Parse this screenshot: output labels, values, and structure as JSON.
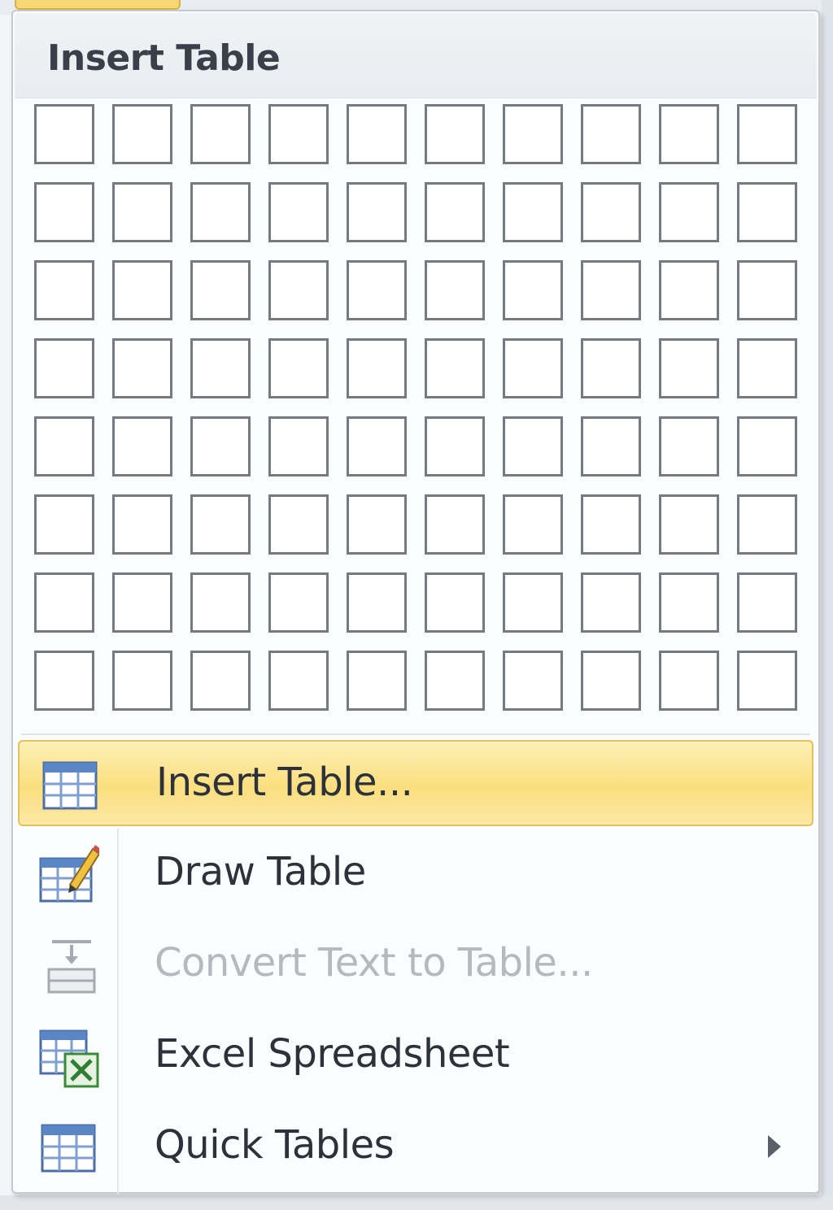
{
  "menu": {
    "header": "Insert Table",
    "grid": {
      "rows": 8,
      "columns": 10
    },
    "items": [
      {
        "label": "Insert Table...",
        "icon": "table-icon",
        "highlighted": true,
        "enabled": true
      },
      {
        "label": "Draw Table",
        "icon": "draw-table-icon",
        "highlighted": false,
        "enabled": true
      },
      {
        "label": "Convert Text to Table...",
        "icon": "convert-text-icon",
        "highlighted": false,
        "enabled": false
      },
      {
        "label": "Excel Spreadsheet",
        "icon": "excel-spreadsheet-icon",
        "highlighted": false,
        "enabled": true
      },
      {
        "label": "Quick Tables",
        "icon": "quick-tables-icon",
        "highlighted": false,
        "enabled": true,
        "submenu": true
      }
    ]
  },
  "colors": {
    "highlight": "#fbde7e",
    "highlight_border": "#e3c15c",
    "cell_border": "#747a82",
    "disabled_text": "#b5b8bd"
  }
}
